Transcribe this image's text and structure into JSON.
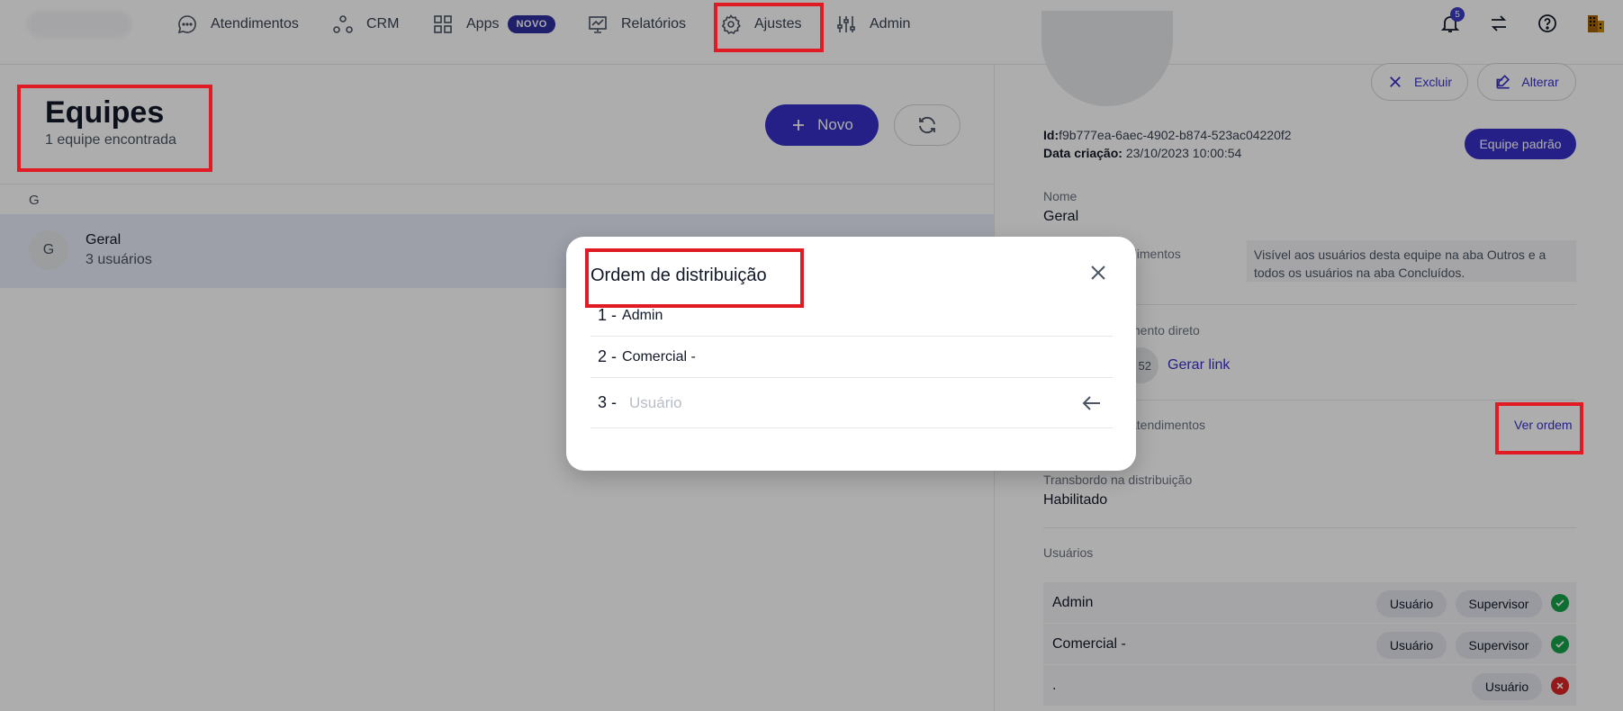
{
  "nav": {
    "items": [
      {
        "label": "Atendimentos",
        "icon": "chat-icon"
      },
      {
        "label": "CRM",
        "icon": "crm-icon"
      },
      {
        "label": "Apps",
        "icon": "grid-icon",
        "badge": "NOVO"
      },
      {
        "label": "Relatórios",
        "icon": "chart-icon"
      },
      {
        "label": "Ajustes",
        "icon": "gear-icon"
      },
      {
        "label": "Admin",
        "icon": "sliders-icon"
      }
    ],
    "notifications_count": "5"
  },
  "teams": {
    "title": "Equipes",
    "subtitle": "1 equipe encontrada",
    "new_button": "Novo",
    "group_letter": "G",
    "list": [
      {
        "initial": "G",
        "name": "Geral",
        "count": "3 usuários"
      }
    ]
  },
  "detail": {
    "delete_button": "Excluir",
    "edit_button": "Alterar",
    "id_label": "Id:",
    "id_value": "f9b777ea-6aec-4902-b874-523ac04220f2",
    "created_label": "Data criação:",
    "created_value": "23/10/2023 10:00:54",
    "default_team_button": "Equipe padrão",
    "name_label": "Nome",
    "name_value": "Geral",
    "visibility_label": "dimentos",
    "visibility_text_1": "Visível aos usuários desta equipe na aba Outros e a",
    "visibility_text_2": "todos os usuários na aba Concluídos.",
    "direct_label": "mento direto",
    "direct_code": "52",
    "generate_link": "Gerar link",
    "distribution_label": "atendimentos",
    "see_order": "Ver ordem",
    "overflow_label": "Transbordo na distribuição",
    "overflow_value": "Habilitado",
    "users_label": "Usuários",
    "users": [
      {
        "name": "Admin",
        "tags": [
          "Usuário",
          "Supervisor"
        ],
        "active": true
      },
      {
        "name": "Comercial -",
        "tags": [
          "Usuário",
          "Supervisor"
        ],
        "active": true
      },
      {
        "name": ".",
        "tags": [
          "Usuário"
        ],
        "active": false
      }
    ]
  },
  "modal": {
    "title": "Ordem de distribuição",
    "rows": [
      {
        "num": "1 -",
        "name": "Admin"
      },
      {
        "num": "2 -",
        "name": "Comercial -"
      }
    ],
    "input_num": "3 -",
    "input_placeholder": "Usuário"
  },
  "colors": {
    "accent": "#3730c8",
    "highlight": "#e01b24",
    "ok": "#16a34a",
    "error": "#dc2626"
  }
}
